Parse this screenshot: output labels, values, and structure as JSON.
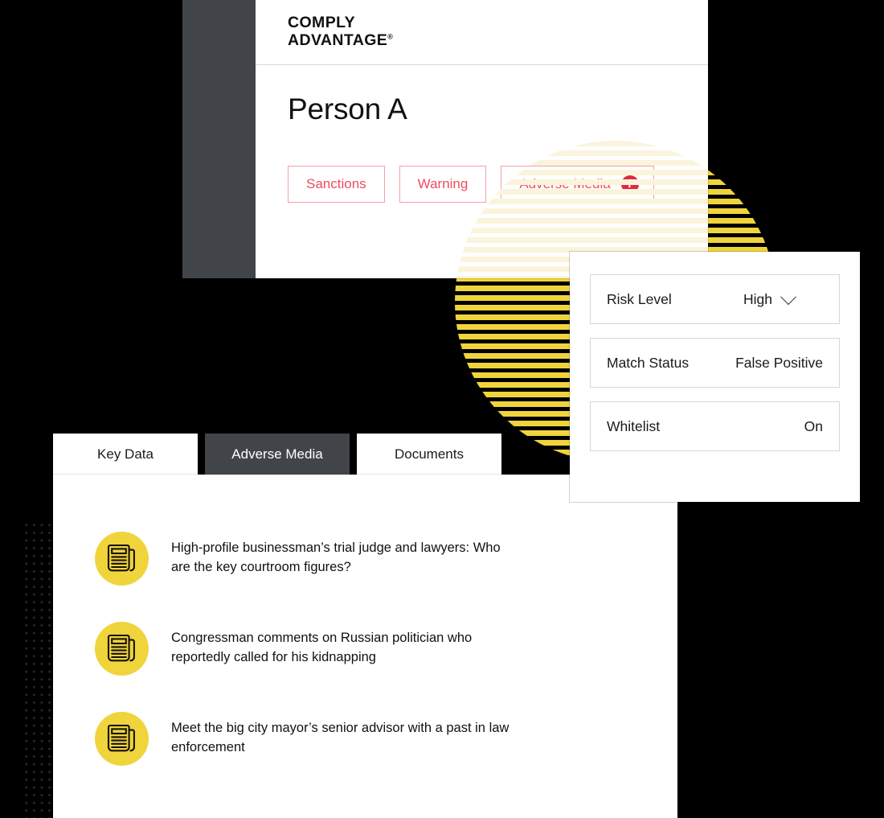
{
  "brand": {
    "logo_line1": "COMPLY",
    "logo_line2": "ADVANTAGE",
    "registered_mark": "®",
    "accent_yellow": "#F0D43C",
    "accent_red": "#EE4C5C",
    "info_badge_red": "#DE2B3F",
    "dark_panel": "#414549",
    "background": "#000000"
  },
  "profile": {
    "name": "Person A",
    "flags": [
      {
        "label": "Sanctions",
        "has_info_icon": false
      },
      {
        "label": "Warning",
        "has_info_icon": false
      },
      {
        "label": "Adverse Media",
        "has_info_icon": true,
        "info_glyph": "i"
      }
    ]
  },
  "detail_panel": {
    "rows": [
      {
        "label": "Risk Level",
        "value": "High",
        "control": "dropdown"
      },
      {
        "label": "Match Status",
        "value": "False Positive",
        "control": "text"
      },
      {
        "label": "Whitelist",
        "value": "On",
        "control": "text"
      }
    ]
  },
  "media_card": {
    "tabs": [
      {
        "label": "Key Data",
        "active": false
      },
      {
        "label": "Adverse Media",
        "active": true
      },
      {
        "label": "Documents",
        "active": false
      }
    ],
    "articles": [
      {
        "icon": "newspaper-icon",
        "headline": "High-profile businessman’s trial judge and lawyers: Who are the key courtroom figures?"
      },
      {
        "icon": "newspaper-icon",
        "headline": "Congressman comments on Russian politician who reportedly called for his kidnapping"
      },
      {
        "icon": "newspaper-icon",
        "headline": "Meet the big city mayor’s senior advisor with a past in law enforcement"
      }
    ]
  }
}
